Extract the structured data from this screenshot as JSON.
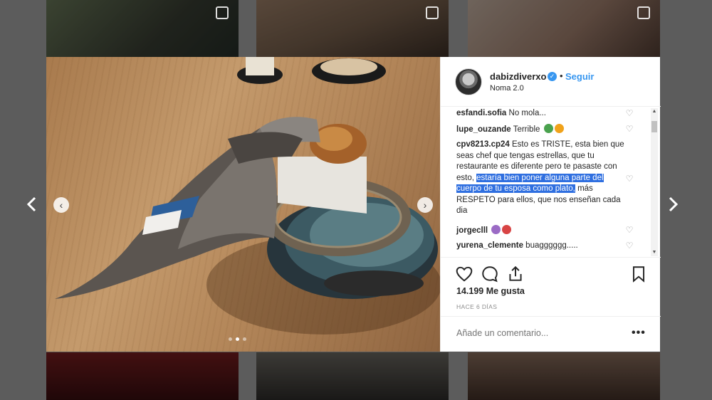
{
  "post": {
    "username": "dabizdiverxo",
    "separator": "•",
    "follow_label": "Seguir",
    "location": "Noma 2.0",
    "likes": "14.199 Me gusta",
    "date": "HACE 6 DÍAS",
    "add_comment_placeholder": "Añade un comentario...",
    "more_label": "•••"
  },
  "comments": [
    {
      "user": "esfandi.sofia",
      "text": "No mola..."
    },
    {
      "user": "lupe_ouzande",
      "text": "Terrible"
    },
    {
      "user": "cpv8213.cp24",
      "text_before": "Esto es TRISTE, esta bien que seas chef que tengas estrellas, que tu restaurante es diferente pero te pasaste con esto,",
      "highlighted": "estaría bien poner alguna parte del cuerpo de tu esposa como plato,",
      "text_after": "más RESPETO para ellos, que nos enseñan cada dia"
    },
    {
      "user": "jorgeclll",
      "text": ""
    },
    {
      "user": "yurena_clemente",
      "text": "buagggggg....."
    }
  ],
  "icons": {
    "verified": "verified-badge-icon",
    "like": "heart-icon",
    "comment": "comment-icon",
    "share": "share-icon",
    "save": "bookmark-icon"
  },
  "colors": {
    "link_blue": "#3897f0",
    "highlight": "#2f6fe0",
    "text": "#262626",
    "muted": "#8e8e8e"
  },
  "carousel": {
    "dots": 3,
    "active_dot": 2
  }
}
